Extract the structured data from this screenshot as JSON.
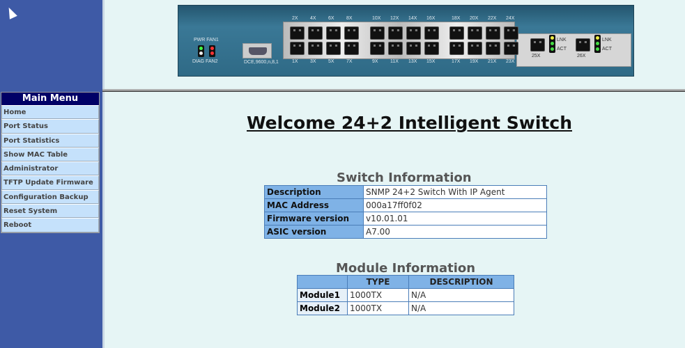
{
  "menu": {
    "title": "Main Menu",
    "items": [
      "Home",
      "Port Status",
      "Port Statistics",
      "Show MAC Table",
      "Administrator",
      "TFTP Update Firmware",
      "Configuration Backup",
      "Reset System",
      "Reboot"
    ]
  },
  "panel": {
    "led_top": "PWR FAN1",
    "led_bottom": "DIAG FAN2",
    "console": "DCE,9600,n,8,1",
    "top_ports": [
      "2X",
      "4X",
      "6X",
      "8X",
      "10X",
      "12X",
      "14X",
      "16X",
      "18X",
      "20X",
      "22X",
      "24X"
    ],
    "bottom_ports": [
      "1X",
      "3X",
      "5X",
      "7X",
      "9X",
      "11X",
      "13X",
      "15X",
      "17X",
      "19X",
      "21X",
      "23X"
    ],
    "module_ports": [
      "25X",
      "26X"
    ],
    "lnk": "LNK",
    "act": "ACT"
  },
  "page_title": "Welcome 24+2 Intelligent Switch",
  "switch_info": {
    "title": "Switch Information",
    "rows": [
      {
        "k": "Description",
        "v": "SNMP 24+2 Switch With IP Agent"
      },
      {
        "k": "MAC Address",
        "v": "000a17ff0f02"
      },
      {
        "k": "Firmware version",
        "v": "v10.01.01"
      },
      {
        "k": "ASIC version",
        "v": "A7.00"
      }
    ]
  },
  "module_info": {
    "title": "Module Information",
    "headers": [
      "",
      "TYPE",
      "DESCRIPTION"
    ],
    "rows": [
      {
        "name": "Module1",
        "type": "1000TX",
        "desc": "N/A"
      },
      {
        "name": "Module2",
        "type": "1000TX",
        "desc": "N/A"
      }
    ]
  }
}
